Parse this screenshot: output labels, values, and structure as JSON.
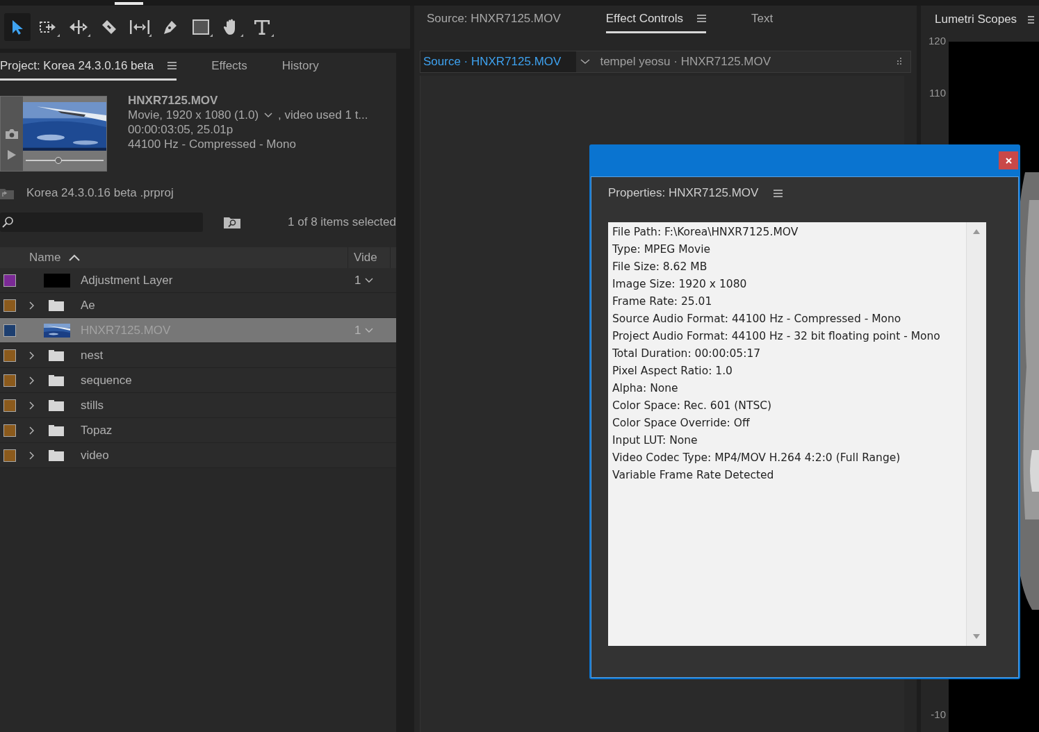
{
  "toolbar": {
    "tools": [
      {
        "kind": "selection",
        "selected": true
      },
      {
        "kind": "track-select",
        "selected": false
      },
      {
        "kind": "ripple",
        "selected": false
      },
      {
        "kind": "razor",
        "selected": false
      },
      {
        "kind": "slip",
        "selected": false
      },
      {
        "kind": "pen",
        "selected": false
      },
      {
        "kind": "rectangle",
        "selected": false
      },
      {
        "kind": "hand",
        "selected": false
      },
      {
        "kind": "type",
        "selected": false
      }
    ]
  },
  "project_panel": {
    "tabs": [
      {
        "label": "Project: Korea 24.3.0.16 beta",
        "selected": true
      },
      {
        "label": "Effects",
        "selected": false
      },
      {
        "label": "History",
        "selected": false
      }
    ],
    "clip_info": {
      "name": "HNXR7125.MOV",
      "format": "Movie, 1920 x 1080 (1.0)",
      "usage": ", video used 1 t...",
      "duration": "00:00:03:05, 25.01p",
      "audio": "44100 Hz - Compressed - Mono",
      "scrubber": {
        "level": 0.42
      }
    },
    "project_file": "Korea 24.3.0.16 beta .prproj",
    "selection_count": "1 of 8 items selected",
    "table": {
      "columns": [
        {
          "label": "Name",
          "sorted": true
        },
        {
          "label": "Vide"
        }
      ],
      "rows": [
        {
          "kind": "adjustment",
          "name": "Adjustment Layer",
          "color": "#7b2a96",
          "video": "1",
          "selected": false
        },
        {
          "kind": "bin",
          "name": "Ae",
          "color": "#8b5a1c",
          "selected": false
        },
        {
          "kind": "clip",
          "name": "HNXR7125.MOV",
          "color": "#1d3f70",
          "video": "1",
          "selected": true
        },
        {
          "kind": "bin",
          "name": "nest",
          "color": "#8b5a1c",
          "selected": false
        },
        {
          "kind": "bin",
          "name": "sequence",
          "color": "#8b5a1c",
          "selected": false
        },
        {
          "kind": "bin",
          "name": "stills",
          "color": "#8b5a1c",
          "selected": false
        },
        {
          "kind": "bin",
          "name": "Topaz",
          "color": "#8b5a1c",
          "selected": false
        },
        {
          "kind": "bin",
          "name": "video",
          "color": "#8b5a1c",
          "selected": false
        }
      ]
    }
  },
  "viewer_panel": {
    "tabs": [
      {
        "label": "Source: HNXR7125.MOV",
        "selected": false
      },
      {
        "label": "Effect Controls",
        "selected": true
      },
      {
        "label": "Text",
        "selected": false
      }
    ],
    "source_bar": {
      "source": "Source · HNXR7125.MOV",
      "sequence": "tempel yeosu · HNXR7125.MOV"
    }
  },
  "scopes_panel": {
    "title": "Lumetri Scopes",
    "ticks": [
      "120",
      "110",
      "-10"
    ]
  },
  "properties_dialog": {
    "title": "Properties: HNXR7125.MOV",
    "lines": [
      "File Path: F:\\Korea\\HNXR7125.MOV",
      "Type: MPEG Movie",
      "File Size: 8.62 MB",
      "Image Size: 1920 x 1080",
      "Frame Rate: 25.01",
      "Source Audio Format: 44100 Hz - Compressed - Mono",
      "Project Audio Format: 44100 Hz - 32 bit floating point - Mono",
      "Total Duration: 00:00:05:17",
      "Pixel Aspect Ratio: 1.0",
      "Alpha: None",
      "Color Space: Rec. 601 (NTSC)",
      "Color Space Override: Off",
      "Input LUT: None",
      "Video Codec Type: MP4/MOV H.264 4:2:0  (Full Range)",
      "Variable Frame Rate Detected"
    ]
  }
}
